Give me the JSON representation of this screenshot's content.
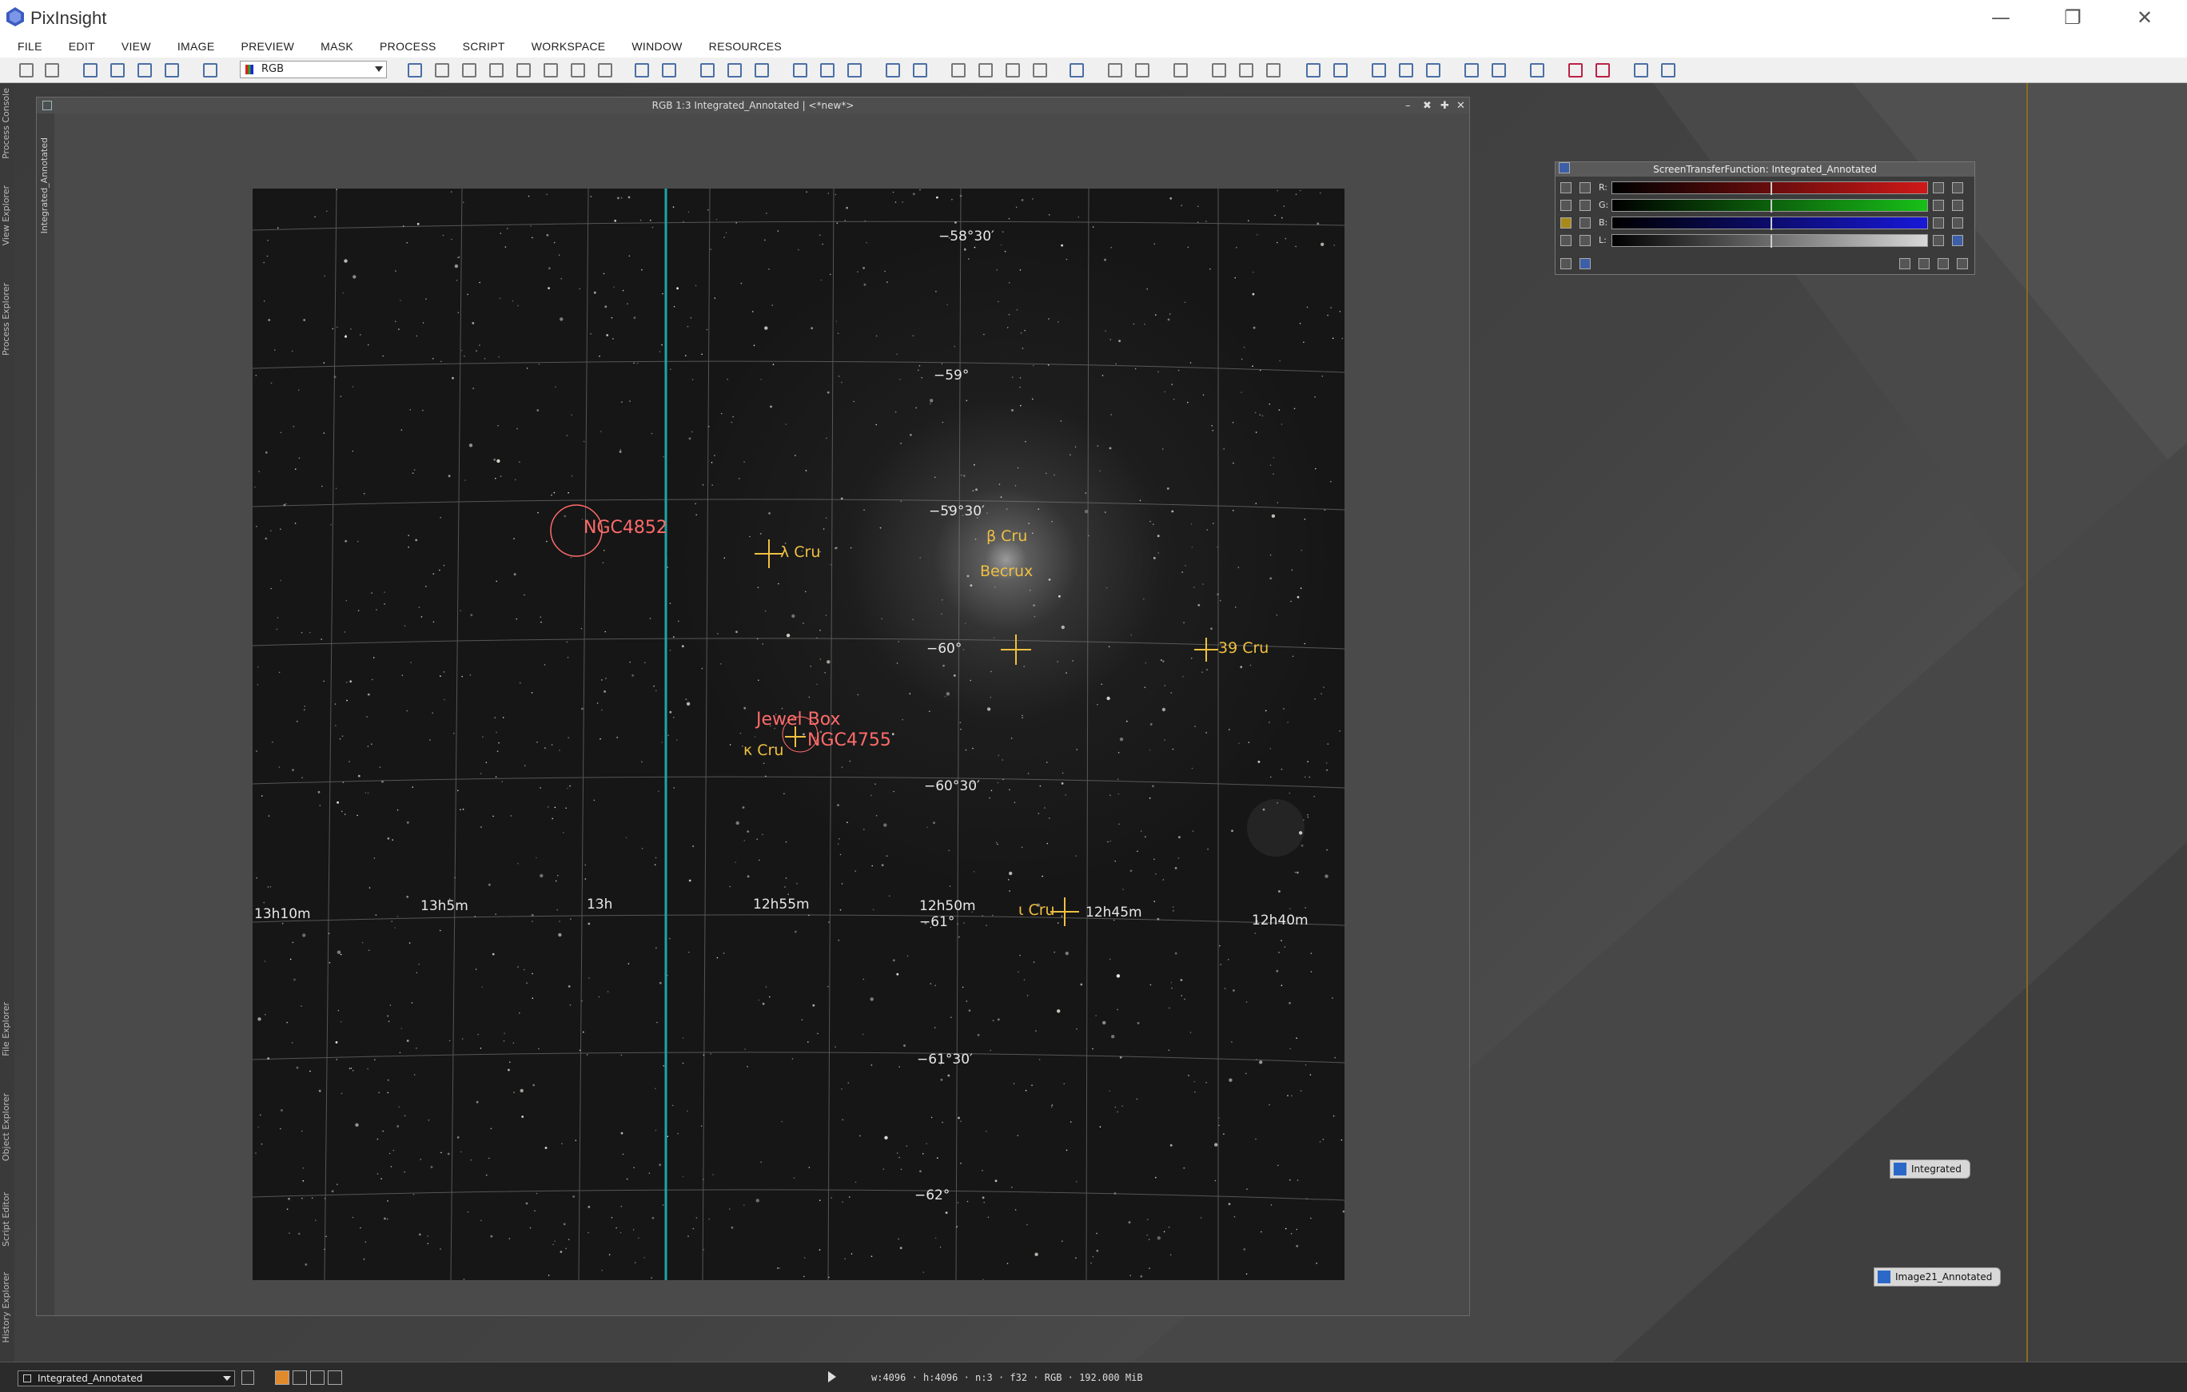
{
  "app": {
    "title": "PixInsight"
  },
  "menu": {
    "items": [
      "FILE",
      "EDIT",
      "VIEW",
      "IMAGE",
      "PREVIEW",
      "MASK",
      "PROCESS",
      "SCRIPT",
      "WORKSPACE",
      "WINDOW",
      "RESOURCES"
    ]
  },
  "toolbar": {
    "channel_select": "RGB"
  },
  "left_dock": {
    "tabs": [
      "Process Console",
      "View Explorer",
      "Process Explorer",
      "File Explorer",
      "Object Explorer",
      "Script Editor",
      "History Explorer"
    ]
  },
  "image_window": {
    "title": "RGB 1:3 Integrated_Annotated | <*new*>",
    "sidebar_label": "Integrated_Annotated",
    "coords": {
      "dec_5830": "−58°30′",
      "dec_59": "−59°",
      "dec_5930": "−59°30′",
      "dec_60": "−60°",
      "dec_6030": "−60°30′",
      "dec_61": "−61°",
      "dec_6130": "−61°30′",
      "dec_62": "−62°",
      "ra_13h10m": "13h10m",
      "ra_13h5m": "13h5m",
      "ra_13h": "13h",
      "ra_12h55m": "12h55m",
      "ra_12h50m": "12h50m",
      "ra_12h45m": "12h45m",
      "ra_12h40m": "12h40m"
    },
    "labels": {
      "lambda_cru": "λ Cru",
      "ngc4852": "NGC4852",
      "beta_cru": "β Cru",
      "becrux": "Becrux",
      "cru39": "39 Cru",
      "jewel_box": "Jewel Box",
      "ngc4755": "NGC4755",
      "kappa_cru": "κ Cru",
      "iota_cru": "ι Cru"
    }
  },
  "stf": {
    "title": "ScreenTransferFunction: Integrated_Annotated",
    "channels": [
      "R:",
      "G:",
      "B:",
      "L:"
    ],
    "colors": [
      "#d01818",
      "#18c018",
      "#1818d8",
      "#d8d8d8"
    ]
  },
  "workspace_icons": {
    "integrated": "Integrated",
    "image21": "Image21_Annotated"
  },
  "status": {
    "view": "Integrated_Annotated",
    "info": "w:4096 · h:4096 · n:3 · f32 · RGB · 192.000 MiB"
  },
  "colors": {
    "accent": "#4a6fa5",
    "annotation_red": "#ff6b6b",
    "annotation_yellow": "#f0c040",
    "meridian": "#1aa6a6"
  }
}
